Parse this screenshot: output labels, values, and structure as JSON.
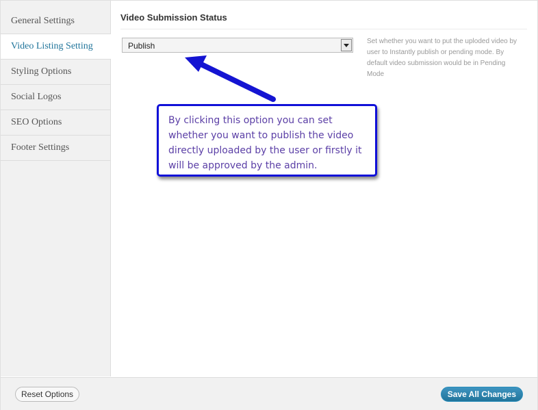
{
  "sidebar": {
    "items": [
      {
        "label": "General Settings",
        "active": false
      },
      {
        "label": "Video Listing Setting",
        "active": true
      },
      {
        "label": "Styling Options",
        "active": false
      },
      {
        "label": "Social Logos",
        "active": false
      },
      {
        "label": "SEO Options",
        "active": false
      },
      {
        "label": "Footer Settings",
        "active": false
      }
    ]
  },
  "main": {
    "section_title": "Video Submission Status",
    "select": {
      "value": "Publish"
    },
    "help_text": "Set whether you want to put the uploded video by user to Instantly publish or pending mode. By default video submission would be in Pending Mode"
  },
  "callout": {
    "text": "By clicking this option you can set whether you want to publish the video directly uploaded by the user or firstly it will be approved by the admin."
  },
  "footer": {
    "reset_label": "Reset Options",
    "save_label": "Save All Changes"
  },
  "colors": {
    "accent": "#21759b",
    "callout_border": "#1010d8",
    "callout_text": "#5b3fa6",
    "arrow": "#1414d2"
  }
}
